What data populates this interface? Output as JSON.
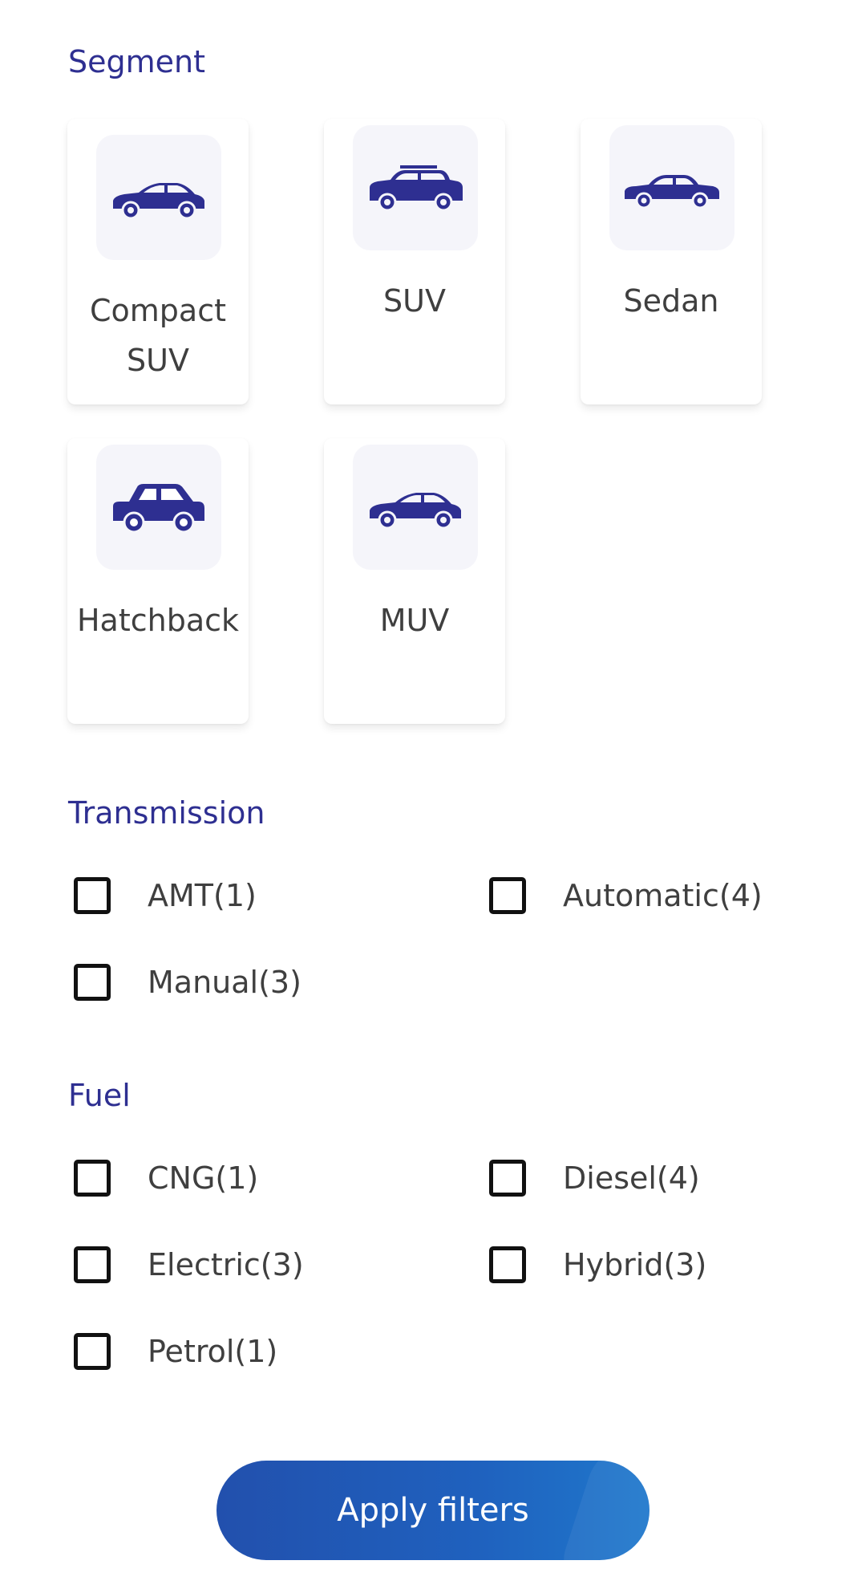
{
  "segment": {
    "title": "Segment",
    "items": [
      {
        "label_line1": "Compact",
        "label_line2": "SUV",
        "icon": "compact-suv-car-icon"
      },
      {
        "label_line1": "SUV",
        "label_line2": "",
        "icon": "suv-car-icon"
      },
      {
        "label_line1": "Sedan",
        "label_line2": "",
        "icon": "sedan-car-icon"
      },
      {
        "label_line1": "Hatchback",
        "label_line2": "",
        "icon": "hatchback-car-icon"
      },
      {
        "label_line1": "MUV",
        "label_line2": "",
        "icon": "muv-car-icon"
      }
    ]
  },
  "transmission": {
    "title": "Transmission",
    "options": [
      "AMT(1)",
      "Automatic(4)",
      "Manual(3)"
    ]
  },
  "fuel": {
    "title": "Fuel",
    "options": [
      "CNG(1)",
      "Diesel(4)",
      "Electric(3)",
      "Hybrid(3)",
      "Petrol(1)"
    ]
  },
  "apply_button": {
    "label": "Apply filters"
  },
  "colors": {
    "accent": "#2e2f91",
    "button_start": "#2250ad",
    "button_end": "#1f78cc"
  }
}
